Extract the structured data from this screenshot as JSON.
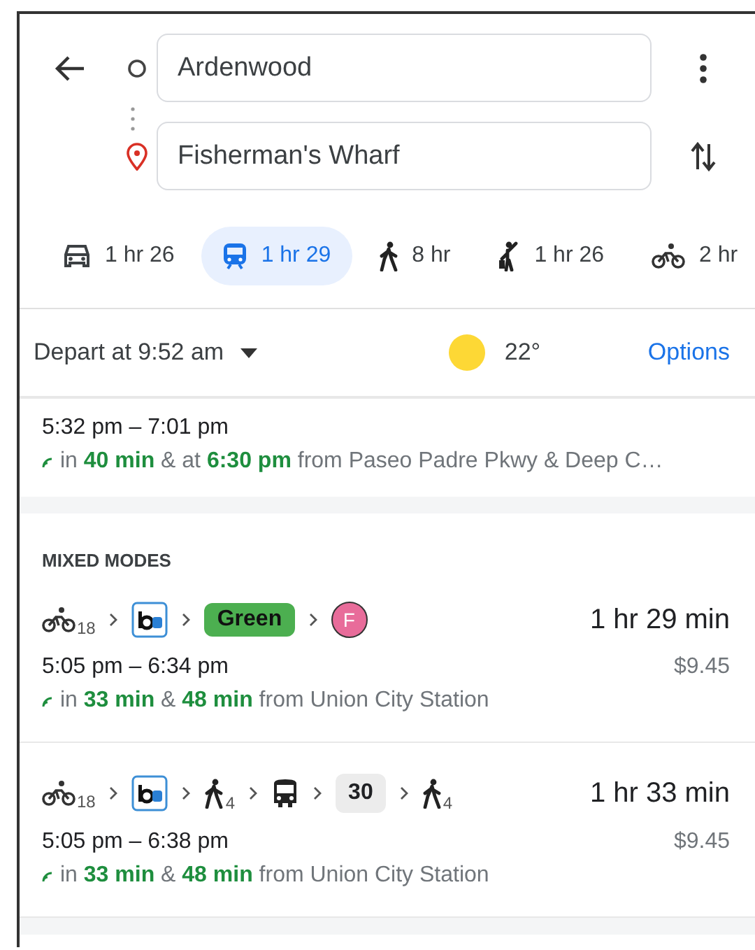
{
  "origin": {
    "value": "Ardenwood"
  },
  "destination": {
    "value": "Fisherman's Wharf"
  },
  "modes": [
    {
      "kind": "car",
      "label": "1 hr 26",
      "selected": false
    },
    {
      "kind": "transit",
      "label": "1 hr 29",
      "selected": true
    },
    {
      "kind": "walk",
      "label": "8 hr",
      "selected": false
    },
    {
      "kind": "ride",
      "label": "1 hr 26",
      "selected": false
    },
    {
      "kind": "bike",
      "label": "2 hr",
      "selected": false
    }
  ],
  "depart": {
    "label": "Depart at 9:52 am",
    "temperature": "22°",
    "options": "Options"
  },
  "partial_route": {
    "times": "5:32 pm – 7:01 pm",
    "live": "in **40 min** & at **6:30 pm** from Paseo Padre Pkwy & Deep C…"
  },
  "section_title": "MIXED MODES",
  "routes": [
    {
      "steps": [
        {
          "kind": "bike",
          "sub": "18"
        },
        {
          "kind": "bart"
        },
        {
          "kind": "line",
          "label": "Green",
          "color": "#4caf50"
        },
        {
          "kind": "stop",
          "label": "F",
          "color": "#e86c9a"
        }
      ],
      "duration": "1 hr 29 min",
      "times": "5:05 pm – 6:34 pm",
      "fare": "$9.45",
      "live": "in **33 min** & **48 min** from Union City Station"
    },
    {
      "steps": [
        {
          "kind": "bike",
          "sub": "18"
        },
        {
          "kind": "bart"
        },
        {
          "kind": "walk",
          "sub": "4"
        },
        {
          "kind": "bus"
        },
        {
          "kind": "chip",
          "label": "30"
        },
        {
          "kind": "walk",
          "sub": "4"
        }
      ],
      "duration": "1 hr 33 min",
      "times": "5:05 pm – 6:38 pm",
      "fare": "$9.45",
      "live": "in **33 min** & **48 min** from Union City Station"
    }
  ]
}
